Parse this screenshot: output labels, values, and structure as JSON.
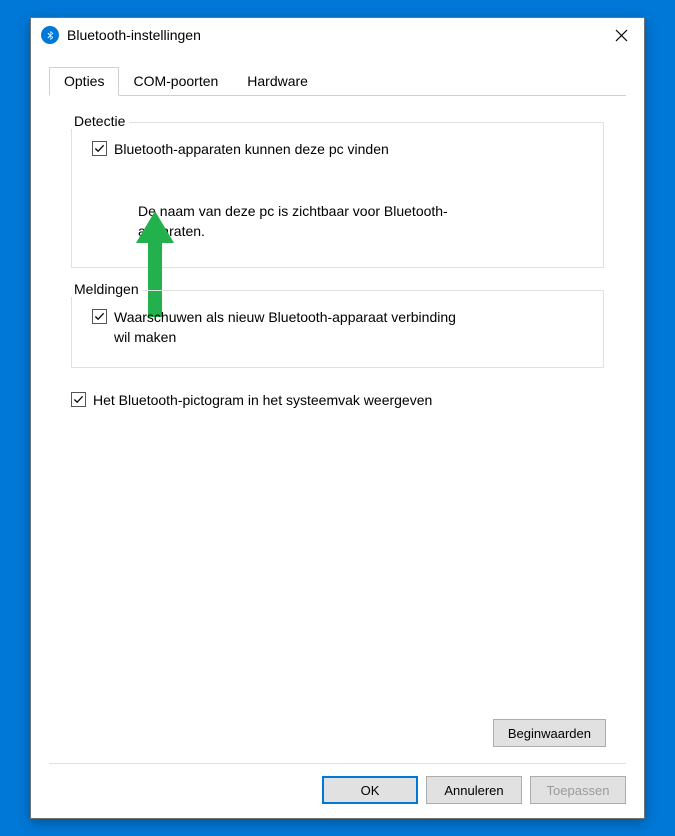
{
  "titlebar": {
    "title": "Bluetooth-instellingen"
  },
  "tabs": [
    {
      "label": "Opties",
      "active": true
    },
    {
      "label": "COM-poorten",
      "active": false
    },
    {
      "label": "Hardware",
      "active": false
    }
  ],
  "detection": {
    "legend": "Detectie",
    "checkbox_label": "Bluetooth-apparaten kunnen deze pc vinden",
    "checked": true,
    "description": "De naam van deze pc is zichtbaar voor Bluetooth-apparaten."
  },
  "notifications": {
    "legend": "Meldingen",
    "checkbox_label": "Waarschuwen als nieuw Bluetooth-apparaat verbinding wil maken",
    "checked": true
  },
  "tray": {
    "checkbox_label": "Het Bluetooth-pictogram in het systeemvak weergeven",
    "checked": true
  },
  "buttons": {
    "defaults": "Beginwaarden",
    "ok": "OK",
    "cancel": "Annuleren",
    "apply": "Toepassen"
  },
  "colors": {
    "accent": "#0078d7",
    "annotation": "#22b14c"
  }
}
